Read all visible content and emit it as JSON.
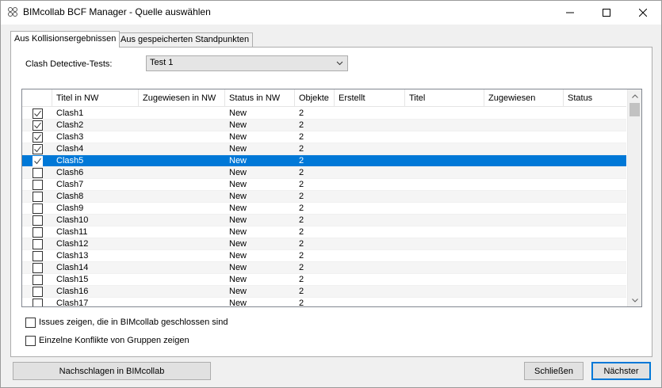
{
  "window": {
    "title": "BIMcollab BCF Manager - Quelle auswählen"
  },
  "tabs": [
    {
      "label": "Aus Kollisionsergebnissen",
      "active": true
    },
    {
      "label": "Aus gespeicherten Standpunkten",
      "active": false
    }
  ],
  "clash": {
    "label": "Clash Detective-Tests:",
    "selected": "Test 1"
  },
  "grid": {
    "columns": [
      "",
      "Titel in NW",
      "Zugewiesen in NW",
      "Status in NW",
      "Objekte",
      "Erstellt",
      "Titel",
      "Zugewiesen",
      "Status"
    ],
    "rows": [
      {
        "checked": true,
        "title": "Clash1",
        "assigned": "",
        "status": "New",
        "objects": "2"
      },
      {
        "checked": true,
        "title": "Clash2",
        "assigned": "",
        "status": "New",
        "objects": "2"
      },
      {
        "checked": true,
        "title": "Clash3",
        "assigned": "",
        "status": "New",
        "objects": "2"
      },
      {
        "checked": true,
        "title": "Clash4",
        "assigned": "",
        "status": "New",
        "objects": "2"
      },
      {
        "checked": true,
        "title": "Clash5",
        "assigned": "",
        "status": "New",
        "objects": "2",
        "selected": true
      },
      {
        "checked": false,
        "title": "Clash6",
        "assigned": "",
        "status": "New",
        "objects": "2"
      },
      {
        "checked": false,
        "title": "Clash7",
        "assigned": "",
        "status": "New",
        "objects": "2"
      },
      {
        "checked": false,
        "title": "Clash8",
        "assigned": "",
        "status": "New",
        "objects": "2"
      },
      {
        "checked": false,
        "title": "Clash9",
        "assigned": "",
        "status": "New",
        "objects": "2"
      },
      {
        "checked": false,
        "title": "Clash10",
        "assigned": "",
        "status": "New",
        "objects": "2"
      },
      {
        "checked": false,
        "title": "Clash11",
        "assigned": "",
        "status": "New",
        "objects": "2"
      },
      {
        "checked": false,
        "title": "Clash12",
        "assigned": "",
        "status": "New",
        "objects": "2"
      },
      {
        "checked": false,
        "title": "Clash13",
        "assigned": "",
        "status": "New",
        "objects": "2"
      },
      {
        "checked": false,
        "title": "Clash14",
        "assigned": "",
        "status": "New",
        "objects": "2"
      },
      {
        "checked": false,
        "title": "Clash15",
        "assigned": "",
        "status": "New",
        "objects": "2"
      },
      {
        "checked": false,
        "title": "Clash16",
        "assigned": "",
        "status": "New",
        "objects": "2"
      },
      {
        "checked": false,
        "title": "Clash17",
        "assigned": "",
        "status": "New",
        "objects": "2"
      }
    ]
  },
  "options": [
    {
      "label": "Issues zeigen, die in BIMcollab geschlossen sind",
      "checked": false
    },
    {
      "label": "Einzelne Konflikte von Gruppen zeigen",
      "checked": false
    }
  ],
  "buttons": {
    "lookup": "Nachschlagen in BIMcollab",
    "close": "Schließen",
    "next": "Nächster"
  },
  "colors": {
    "selection": "#0078d7",
    "accent": "#0078d7"
  },
  "icons": {
    "app": "bimcollab-logo-icon",
    "check": "checkmark-icon",
    "dropdown": "chevron-down-icon"
  }
}
